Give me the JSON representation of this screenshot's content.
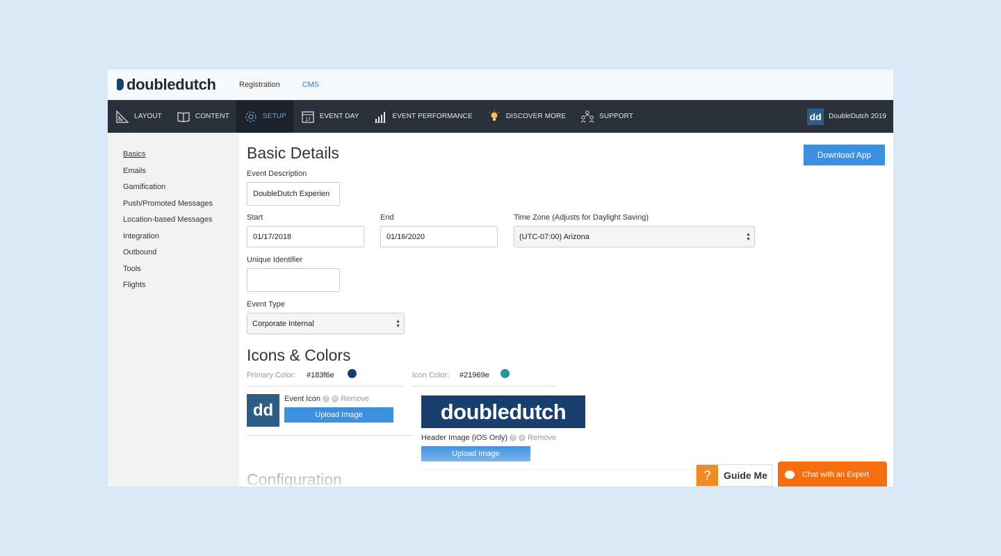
{
  "topbar": {
    "logo_text": "doubledutch",
    "links": [
      {
        "label": "Registration"
      },
      {
        "label": "CMS"
      }
    ]
  },
  "nav": {
    "items": [
      {
        "label": "Layout",
        "icon": "triangle-ruler-icon"
      },
      {
        "label": "Content",
        "icon": "book-icon"
      },
      {
        "label": "Setup",
        "icon": "gear-icon"
      },
      {
        "label": "Event Day",
        "icon": "calendar-icon"
      },
      {
        "label": "Event Performance",
        "icon": "bar-chart-icon"
      },
      {
        "label": "Discover More",
        "icon": "lightbulb-icon"
      },
      {
        "label": "Support",
        "icon": "people-icon"
      }
    ],
    "calendar_day": "17",
    "event_badge": "dd",
    "event_name": "DoubleDutch 2019"
  },
  "sidebar": {
    "items": [
      {
        "label": "Basics"
      },
      {
        "label": "Emails"
      },
      {
        "label": "Gamification"
      },
      {
        "label": "Push/Promoted Messages"
      },
      {
        "label": "Location-based Messages"
      },
      {
        "label": "Integration"
      },
      {
        "label": "Outbound"
      },
      {
        "label": "Tools"
      },
      {
        "label": "Flights"
      }
    ]
  },
  "main": {
    "download_label": "Download App",
    "basic_details": {
      "title": "Basic Details",
      "event_description_label": "Event Description",
      "event_description_value": "DoubleDutch Experien",
      "start_label": "Start",
      "start_value": "01/17/2018",
      "end_label": "End",
      "end_value": "01/16/2020",
      "timezone_label": "Time Zone (Adjusts for Daylight Saving)",
      "timezone_value": "(UTC-07:00) Arizona",
      "unique_id_label": "Unique Identifier",
      "unique_id_value": "",
      "event_type_label": "Event Type",
      "event_type_value": "Corporate Internal"
    },
    "icons_colors": {
      "title": "Icons & Colors",
      "primary_label": "Primary Color:",
      "primary_value": "#183f6e",
      "icon_color_label": "Icon Color:",
      "icon_color_value": "#21969e",
      "event_icon_label": "Event Icon",
      "remove_label": "Remove",
      "upload_label": "Upload Image",
      "event_icon_badge": "dd",
      "header_logo_text": "doubledutch",
      "header_image_label": "Header Image (iOS Only)",
      "header_remove_label": "Remove",
      "header_upload_label": "Upload Image",
      "help_glyph": "?",
      "remove_glyph": "×"
    },
    "configuration_title": "Configuration"
  },
  "widgets": {
    "guide_q": "?",
    "guide_label": "Guide Me",
    "chat_label": "Chat with an Expert"
  }
}
